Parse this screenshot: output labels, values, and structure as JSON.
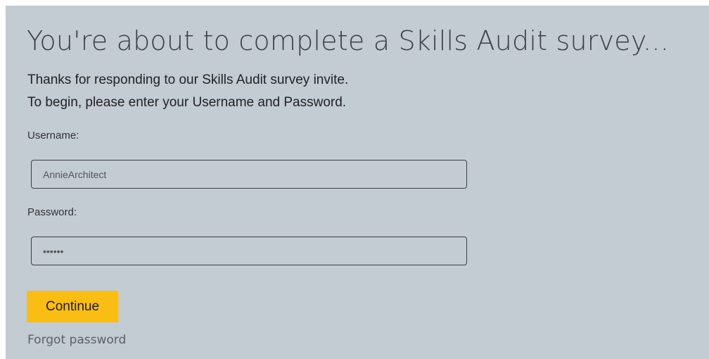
{
  "page": {
    "title": "You're about to complete a Skills Audit survey...",
    "intro_line1": "Thanks for responding to our Skills Audit survey invite.",
    "intro_line2": "To begin, please enter your Username and Password."
  },
  "form": {
    "username_label": "Username:",
    "username_value": "AnnieArchitect",
    "password_label": "Password:",
    "password_value": "••••••",
    "continue_label": "Continue",
    "forgot_label": "Forgot password"
  },
  "colors": {
    "background": "#c3cbd3",
    "button": "#f9bd14",
    "input_border": "#3b3f44"
  }
}
